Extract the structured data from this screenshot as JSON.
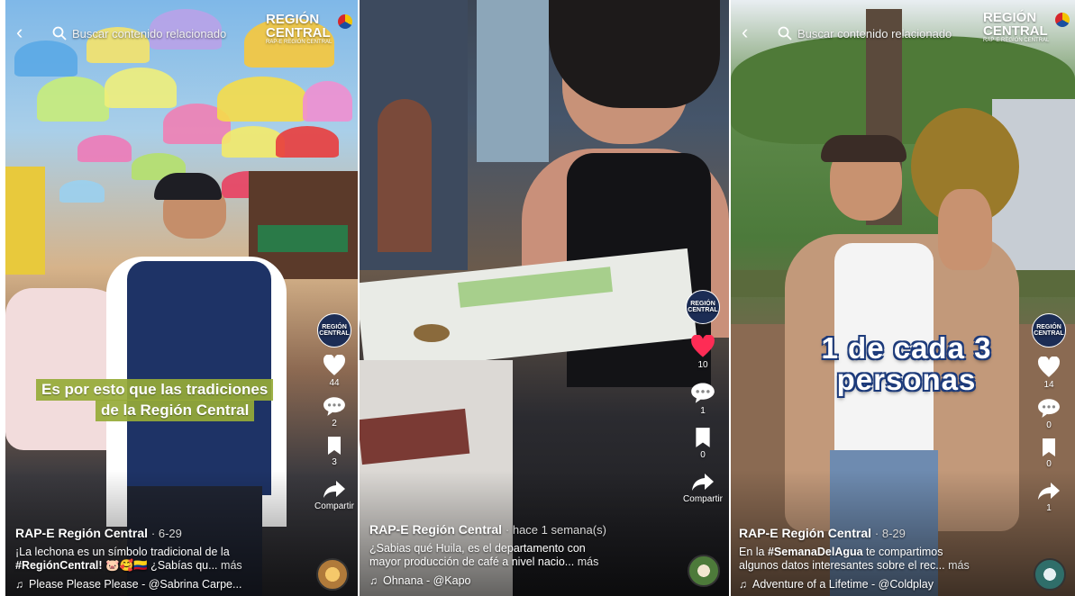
{
  "search_placeholder": "Buscar contenido relacionado",
  "logo": {
    "line1": "REGIÓN",
    "line2": "CENTRAL",
    "sub": "RAP-E REGIÓN CENTRAL"
  },
  "avatar_label": "REGIÓN CENTRAL",
  "share_label": "Compartir",
  "colors": {
    "accent_red": "#fe2c55",
    "caption_green": "#96aa37",
    "caption_outline": "#1c3a7a"
  },
  "videos": [
    {
      "caption": [
        "Es por esto que las tradiciones",
        "de la Región Central"
      ],
      "likes": "44",
      "comments": "2",
      "saves": "3",
      "liked": false,
      "author": "RAP-E Región Central",
      "date": "· 6-29",
      "desc_line1": "¡La lechona es un símbolo tradicional de la",
      "desc_tag": "#RegiónCentral!",
      "desc_rest": " 🐷🥰🇨🇴 ¿Sabías qu...",
      "more": "más",
      "music": "Please Please Please - @Sabrina Carpe..."
    },
    {
      "likes": "10",
      "comments": "1",
      "saves": "0",
      "liked": true,
      "author": "RAP-E Región Central",
      "date": "· hace 1 semana(s)",
      "desc_line1": "¿Sabias qué Huila, es el departamento con",
      "desc_line2": "mayor producción de café a nivel nacio...",
      "more": "más",
      "music": "Ohnana - @Kapo"
    },
    {
      "caption": [
        "1 de cada 3",
        "personas"
      ],
      "likes": "14",
      "comments": "0",
      "saves": "0",
      "shares": "1",
      "liked": false,
      "author": "RAP-E Región Central",
      "date": "· 8-29",
      "desc_pre": "En la ",
      "desc_tag": "#SemanaDelAgua",
      "desc_line1_rest": " te compartimos",
      "desc_line2": "algunos datos interesantes sobre el rec...",
      "more": "más",
      "music": "Adventure of a Lifetime - @Coldplay"
    }
  ]
}
